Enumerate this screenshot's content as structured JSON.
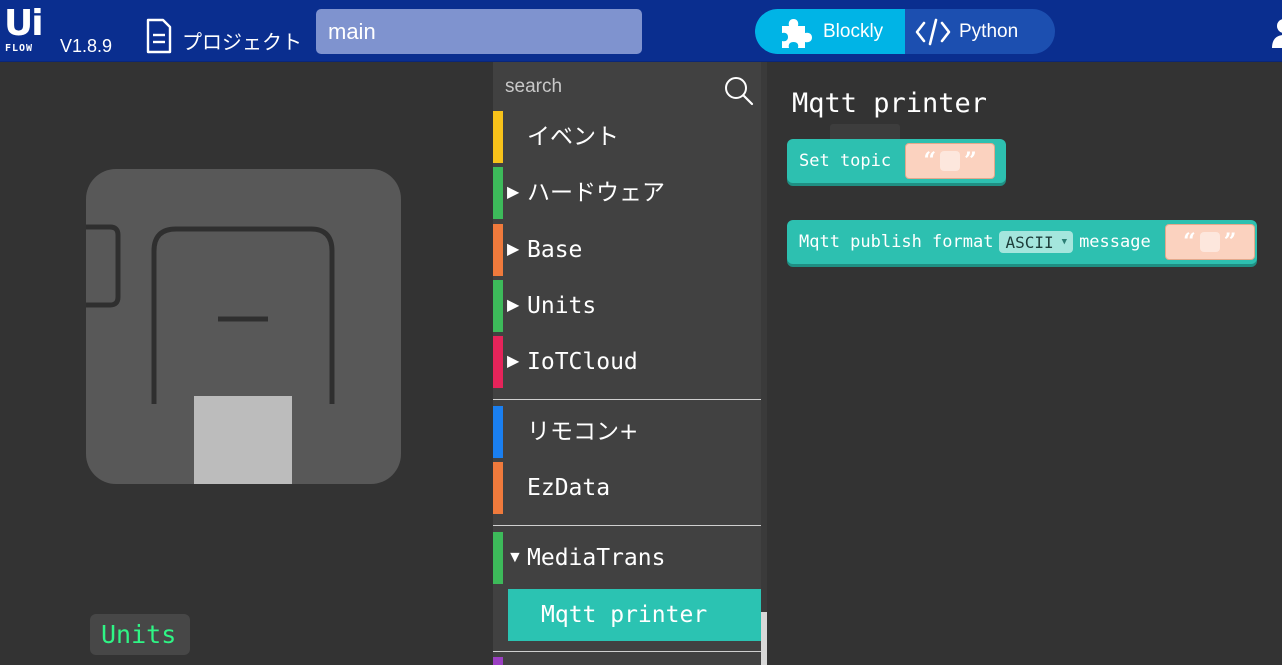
{
  "header": {
    "logo_text": "Ui",
    "logo_sub": "FLOW",
    "version": "V1.8.9",
    "project_label": "プロジェクト",
    "project_name": "main",
    "modes": {
      "blockly": "Blockly",
      "python": "Python",
      "active": "blockly"
    },
    "colors": {
      "header_bg": "#0a2e8f",
      "blockly_active": "#00b4e6"
    }
  },
  "device": {
    "badge": "Units",
    "badge_color": "#2ff585"
  },
  "toolbox": {
    "search": {
      "placeholder": "search",
      "icon": "search-icon"
    },
    "categories": [
      {
        "label": "イベント",
        "color": "#f7c21a",
        "arrow": ""
      },
      {
        "label": "ハードウェア",
        "color": "#3dba5a",
        "arrow": "▶"
      },
      {
        "label": "Base",
        "color": "#ef7a3c",
        "arrow": "▶"
      },
      {
        "label": "Units",
        "color": "#3dba5a",
        "arrow": "▶"
      },
      {
        "label": "IoTCloud",
        "color": "#e5245a",
        "arrow": "▶"
      },
      {
        "label": "リモコン+",
        "color": "#1a7ff0",
        "arrow": ""
      },
      {
        "label": "EzData",
        "color": "#ef7a3c",
        "arrow": ""
      },
      {
        "label": "MediaTrans",
        "color": "#3dba5a",
        "arrow": "▼"
      }
    ],
    "selected_sub": "Mqtt printer",
    "selected_color": "#2bc3b2"
  },
  "flyout": {
    "title": "Mqtt printer",
    "blocks": {
      "set_topic": {
        "label": "Set topic",
        "open_quote": "“",
        "close_quote": "”"
      },
      "publish": {
        "label1": "Mqtt publish format",
        "format_value": "ASCII",
        "caret": "▼",
        "label2": "message",
        "open_quote": "“",
        "close_quote": "”"
      }
    },
    "block_color": "#2dc0b0",
    "string_color": "#fbd2bf"
  }
}
